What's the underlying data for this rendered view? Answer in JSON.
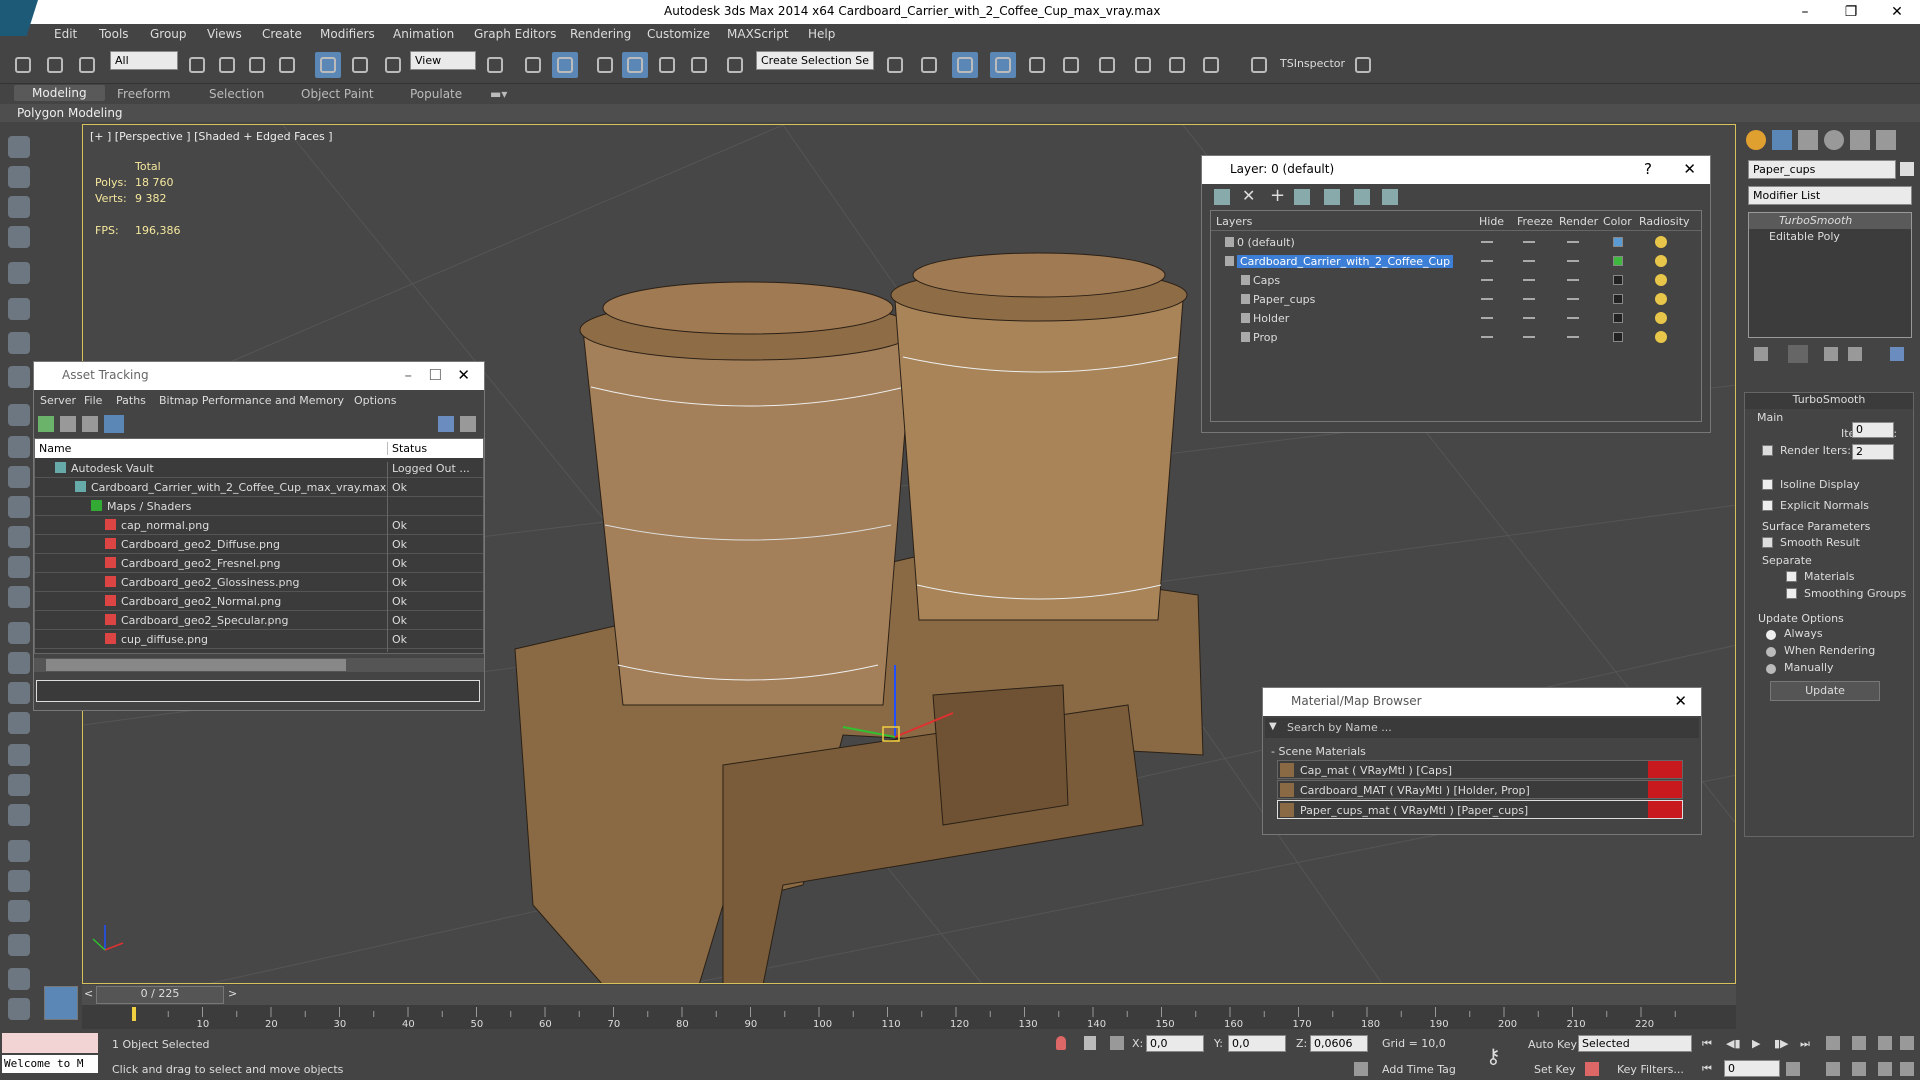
{
  "window": {
    "title": "Autodesk 3ds Max  2014 x64      Cardboard_Carrier_with_2_Coffee_Cup_max_vray.max"
  },
  "menu": [
    "Edit",
    "Tools",
    "Group",
    "Views",
    "Create",
    "Modifiers",
    "Animation",
    "Graph Editors",
    "Rendering",
    "Customize",
    "MAXScript",
    "Help"
  ],
  "toolbar": {
    "filter": "All",
    "ref_coord": "View",
    "selection_set": "Create Selection Se",
    "tsinspector": "TSInspector"
  },
  "ribbon": {
    "tabs": [
      "Modeling",
      "Freeform",
      "Selection",
      "Object Paint",
      "Populate"
    ],
    "sub": "Polygon Modeling"
  },
  "viewport": {
    "label": "[+ ] [Perspective ] [Shaded + Edged Faces ]",
    "stats": {
      "total": "Total",
      "polys_label": "Polys:",
      "polys": "18 760",
      "verts_label": "Verts:",
      "verts": "9 382",
      "fps_label": "FPS:",
      "fps": "196,386"
    }
  },
  "asset_tracking": {
    "title": "Asset Tracking",
    "menu": [
      "Server",
      "File",
      "Paths",
      "Bitmap Performance and Memory",
      "Options"
    ],
    "columns": [
      "Name",
      "Status"
    ],
    "rows": [
      {
        "name": "Autodesk Vault",
        "status": "Logged Out ..."
      },
      {
        "name": "Cardboard_Carrier_with_2_Coffee_Cup_max_vray.max",
        "status": "Ok"
      },
      {
        "name": "Maps / Shaders",
        "status": ""
      },
      {
        "name": "cap_normal.png",
        "status": "Ok"
      },
      {
        "name": "Cardboard_geo2_Diffuse.png",
        "status": "Ok"
      },
      {
        "name": "Cardboard_geo2_Fresnel.png",
        "status": "Ok"
      },
      {
        "name": "Cardboard_geo2_Glossiness.png",
        "status": "Ok"
      },
      {
        "name": "Cardboard_geo2_Normal.png",
        "status": "Ok"
      },
      {
        "name": "Cardboard_geo2_Specular.png",
        "status": "Ok"
      },
      {
        "name": "cup_diffuse.png",
        "status": "Ok"
      }
    ]
  },
  "layers": {
    "title": "Layer: 0 (default)",
    "help": "?",
    "columns": [
      "Layers",
      "Hide",
      "Freeze",
      "Render",
      "Color",
      "Radiosity"
    ],
    "rows": [
      {
        "name": "0 (default)",
        "color": "#5b9bd5"
      },
      {
        "name": "Cardboard_Carrier_with_2_Coffee_Cup",
        "color": "#3fb83f"
      },
      {
        "name": "Caps",
        "color": "#222222"
      },
      {
        "name": "Paper_cups",
        "color": "#222222"
      },
      {
        "name": "Holder",
        "color": "#222222"
      },
      {
        "name": "Prop",
        "color": "#222222"
      }
    ]
  },
  "material_browser": {
    "title": "Material/Map Browser",
    "search": "Search by Name ...",
    "section": "- Scene Materials",
    "items": [
      "Cap_mat  ( VRayMtl ) [Caps]",
      "Cardboard_MAT  ( VRayMtl ) [Holder, Prop]",
      "Paper_cups_mat  ( VRayMtl ) [Paper_cups]"
    ]
  },
  "command_panel": {
    "object_name": "Paper_cups",
    "modifier_list": "Modifier List",
    "stack": [
      "TurboSmooth",
      "Editable Poly"
    ],
    "rollout": "TurboSmooth",
    "main": "Main",
    "iterations_label": "Iterations:",
    "iterations": "0",
    "render_iters_label": "Render Iters:",
    "render_iters": "2",
    "isoline": "Isoline Display",
    "explicit": "Explicit Normals",
    "surface": "Surface Parameters",
    "smooth": "Smooth Result",
    "separate": "Separate",
    "materials": "Materials",
    "smoothing_groups": "Smoothing Groups",
    "update_options": "Update Options",
    "always": "Always",
    "when_rendering": "When Rendering",
    "manually": "Manually",
    "update": "Update"
  },
  "timeline": {
    "frame": "0 / 225",
    "ticks": [
      "10",
      "20",
      "30",
      "40",
      "50",
      "60",
      "70",
      "80",
      "90",
      "100",
      "110",
      "120",
      "130",
      "140",
      "150",
      "160",
      "170",
      "180",
      "190",
      "200",
      "210",
      "220"
    ]
  },
  "status": {
    "maxscript": "Welcome to M",
    "selected": "1 Object Selected",
    "prompt": "Click and drag to select and move objects",
    "x_label": "X:",
    "x": "0,0",
    "y_label": "Y:",
    "y": "0,0",
    "z_label": "Z:",
    "z": "0,0606",
    "grid": "Grid = 10,0",
    "add_time_tag": "Add Time Tag",
    "auto_key": "Auto Key",
    "set_key": "Set Key",
    "selected_dd": "Selected",
    "key_filters": "Key Filters...",
    "frame_field": "0"
  }
}
